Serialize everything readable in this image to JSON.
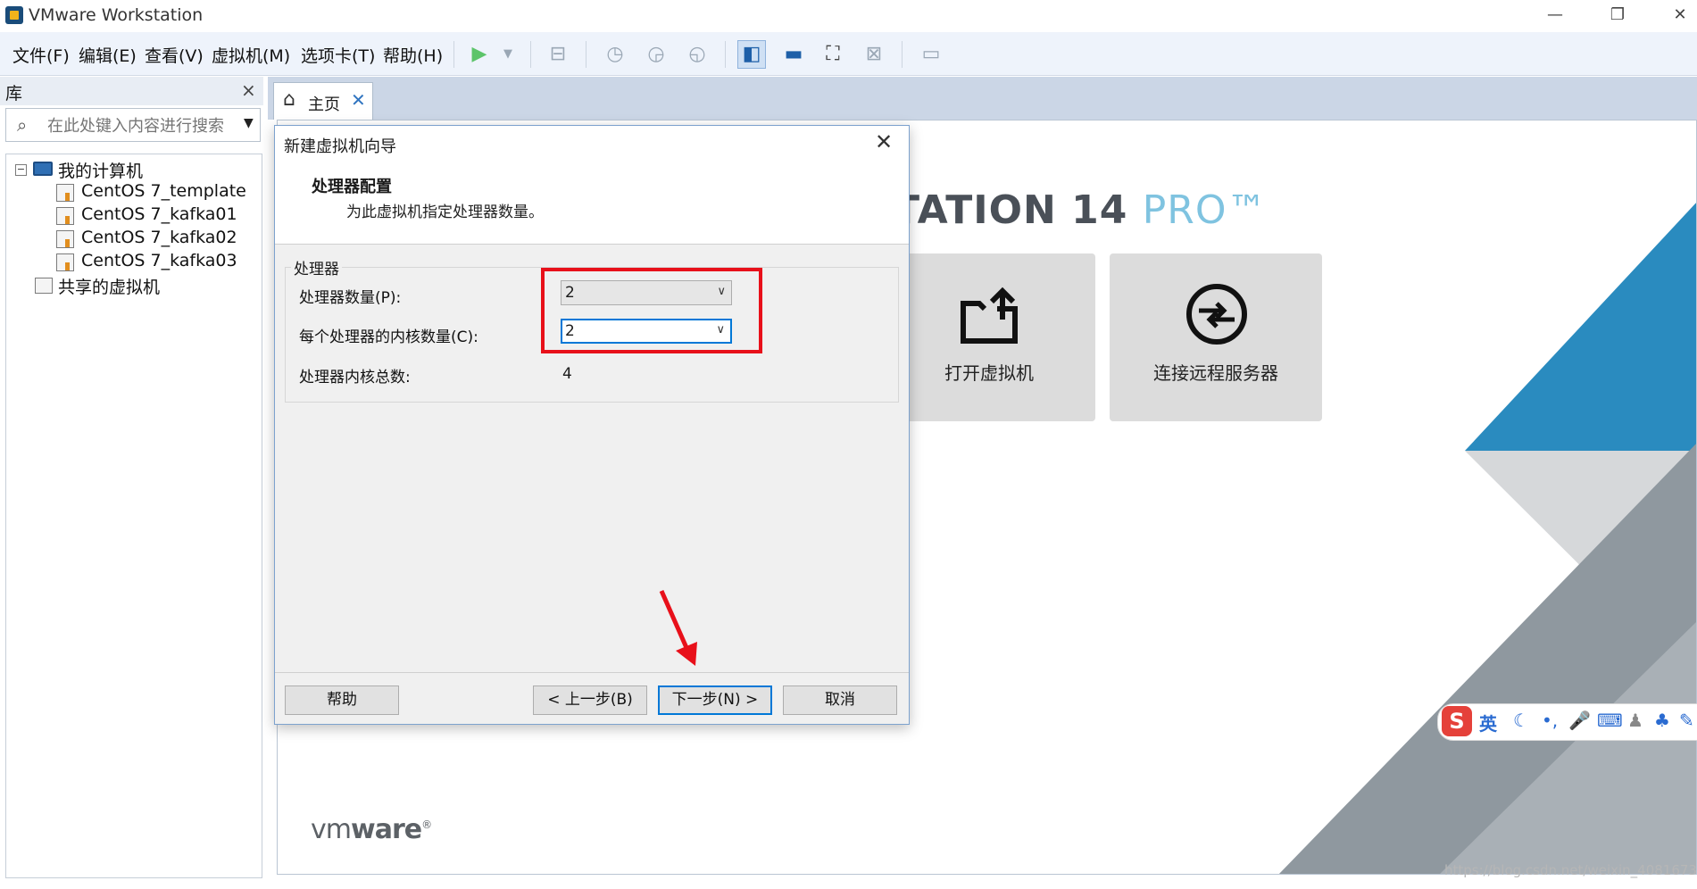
{
  "window": {
    "title": "VMware Workstation",
    "controls": {
      "minimize": "—",
      "restore": "❐",
      "close": "✕"
    }
  },
  "menu": {
    "items": [
      "文件(F)",
      "编辑(E)",
      "查看(V)",
      "虚拟机(M)",
      "选项卡(T)",
      "帮助(H)"
    ]
  },
  "toolbar": {
    "icons": [
      "play-icon",
      "play-dropdown-icon",
      "send-ctrl-alt-del-icon",
      "snapshot-take-icon",
      "snapshot-revert-icon",
      "snapshot-manager-icon",
      "library-view-icon",
      "console-view-icon",
      "fullscreen-icon",
      "unity-icon",
      "thumbnail-bar-icon"
    ]
  },
  "library": {
    "title": "库",
    "close": "×",
    "search_placeholder": "在此处键入内容进行搜索",
    "tree": {
      "root": "我的计算机",
      "vms": [
        "CentOS 7_template",
        "CentOS 7_kafka01",
        "CentOS 7_kafka02",
        "CentOS 7_kafka03"
      ],
      "shared": "共享的虚拟机"
    }
  },
  "tabs": [
    {
      "label": "主页",
      "close": "✕"
    }
  ],
  "home": {
    "brand": "TATION 14",
    "brand_suffix": "PRO™",
    "cards": [
      {
        "label": "打开虚拟机",
        "icon": "open-folder-icon"
      },
      {
        "label": "连接远程服务器",
        "icon": "remote-server-icon"
      }
    ],
    "logo_light": "vm",
    "logo_bold": "ware",
    "logo_mark": "®"
  },
  "dialog": {
    "title": "新建虚拟机向导",
    "close": "✕",
    "heading": "处理器配置",
    "subheading": "为此虚拟机指定处理器数量。",
    "group_label": "处理器",
    "fields": {
      "processor_count_label": "处理器数量(P):",
      "processor_count_value": "2",
      "cores_label": "每个处理器的内核数量(C):",
      "cores_value": "2",
      "total_label": "处理器内核总数:",
      "total_value": "4"
    },
    "buttons": {
      "help": "帮助",
      "back": "< 上一步(B)",
      "next": "下一步(N) >",
      "cancel": "取消"
    }
  },
  "ime": {
    "logo": "S",
    "lang": "英"
  },
  "watermark": "https://blog.csdn.net/weixin_40816738",
  "colors": {
    "annotation": "#e8101a",
    "accent": "#0078d7",
    "pro_blue": "#7fc3e0"
  }
}
